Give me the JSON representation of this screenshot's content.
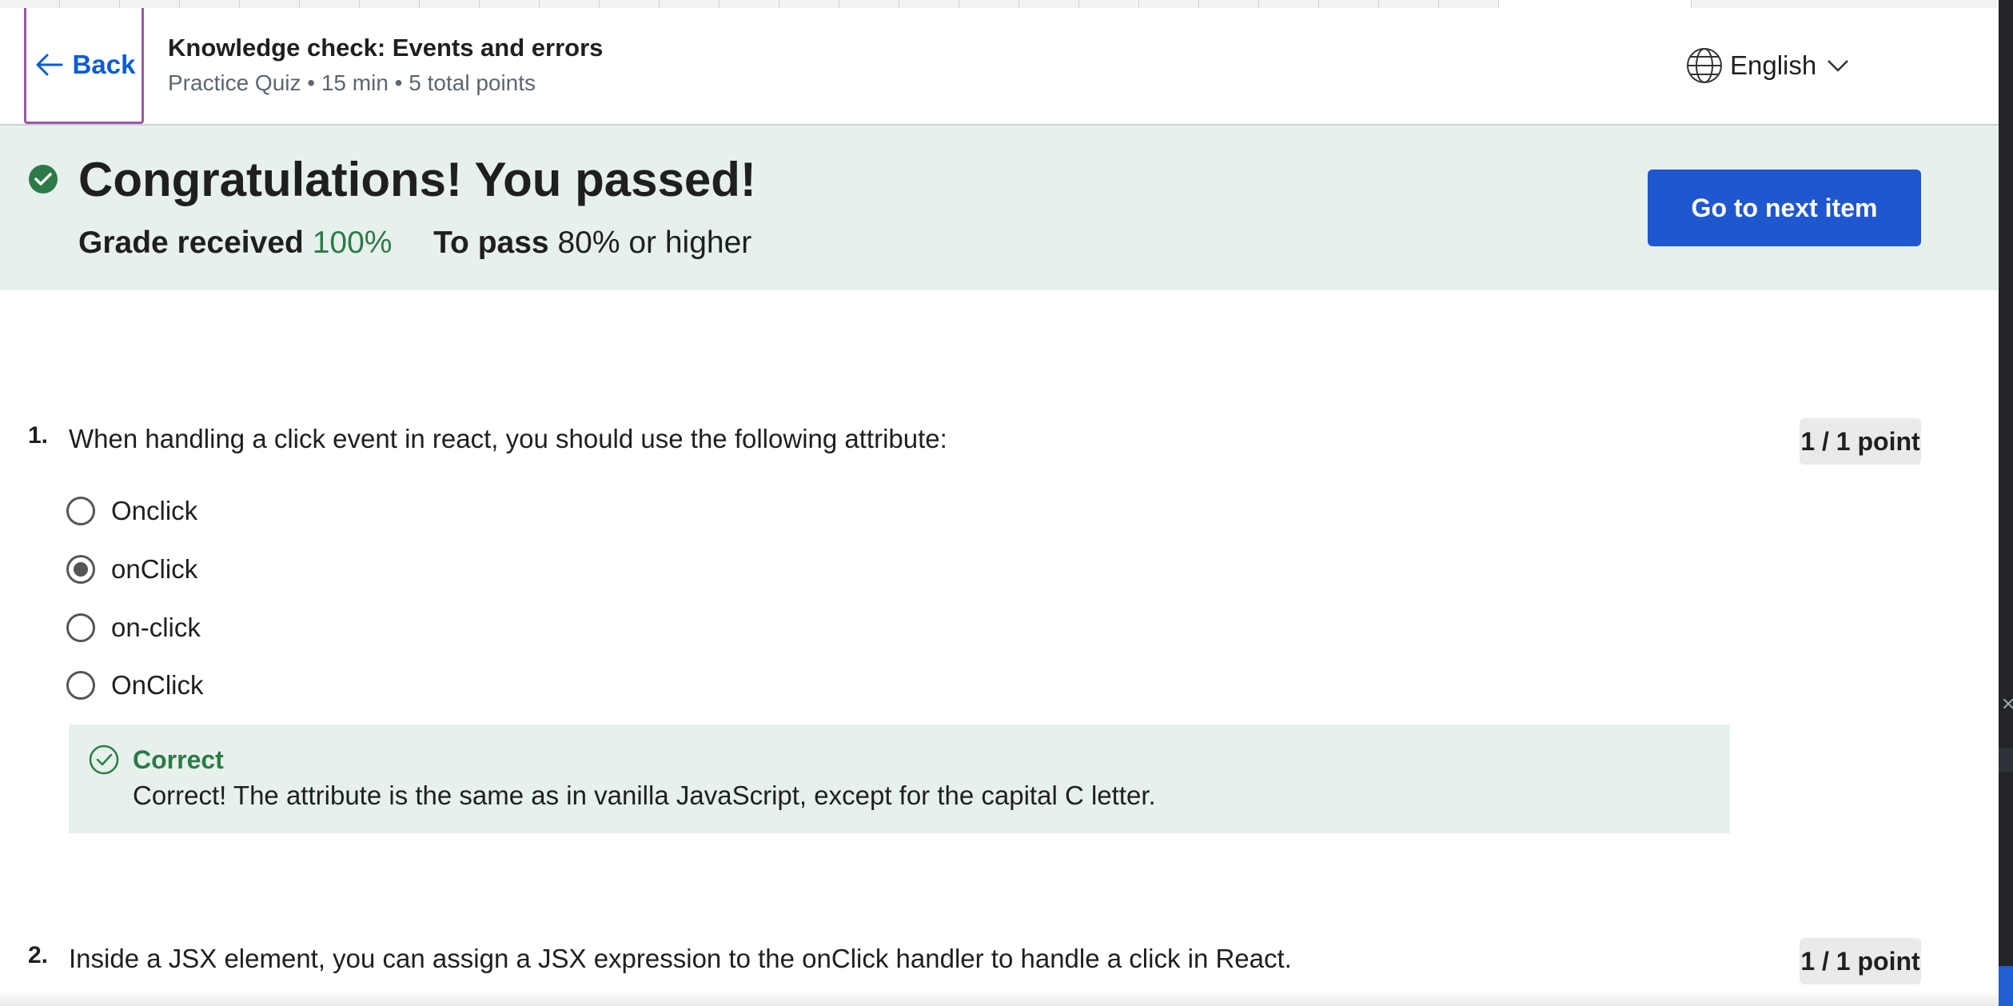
{
  "header": {
    "back_label": "Back",
    "title": "Knowledge check: Events and errors",
    "subtitle": "Practice Quiz • 15 min • 5 total points",
    "language": "English"
  },
  "banner": {
    "title": "Congratulations! You passed!",
    "grade_label": "Grade received",
    "grade_value": "100%",
    "pass_label": "To pass",
    "pass_value": "80% or higher",
    "next_button": "Go to next item"
  },
  "questions": [
    {
      "number": "1.",
      "text": "When handling a click event in react, you should use the following attribute:",
      "points": "1 / 1 point",
      "options": [
        {
          "label": "Onclick",
          "selected": false
        },
        {
          "label": "onClick",
          "selected": true
        },
        {
          "label": "on-click",
          "selected": false
        },
        {
          "label": "OnClick",
          "selected": false
        }
      ],
      "feedback": {
        "title": "Correct",
        "text": "Correct! The attribute is the same as in vanilla JavaScript, except for the capital C letter."
      }
    },
    {
      "number": "2.",
      "text": "Inside a JSX element, you can assign a JSX expression to the onClick handler to handle a click in React.",
      "points": "1 / 1 point"
    }
  ],
  "colors": {
    "accent": "#1f57cf",
    "success": "#2b7a48",
    "banner_bg": "#e7f1ec",
    "back_outline": "#9a5aa6"
  },
  "icons": [
    "arrow-left-icon",
    "globe-icon",
    "chevron-down-icon",
    "check-circle-icon",
    "check-circle-outline-icon",
    "close-icon"
  ]
}
